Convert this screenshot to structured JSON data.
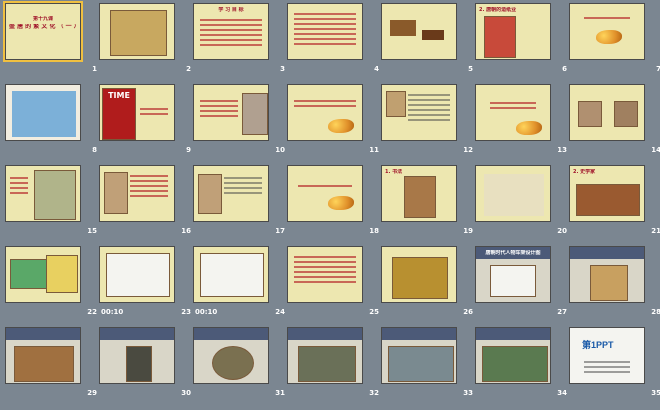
{
  "window": {
    "view": "slide-sorter"
  },
  "colors": {
    "background": "#7b8691",
    "slide_paper": "#ede7b0",
    "accent_red": "#a0142a",
    "number": "#ffffff"
  },
  "slides": [
    {
      "num": "1",
      "title": "第十九课",
      "subtitle": "盛 唐 的 繁 文 化 （ 一 ）",
      "timing": ""
    },
    {
      "num": "2",
      "title": "",
      "timing": ""
    },
    {
      "num": "3",
      "title": "学 习 目 标",
      "timing": ""
    },
    {
      "num": "4",
      "title": "",
      "timing": ""
    },
    {
      "num": "5",
      "title": "",
      "timing": ""
    },
    {
      "num": "6",
      "title": "2. 唐朝的造纸业",
      "timing": ""
    },
    {
      "num": "7",
      "title": "",
      "timing": ""
    },
    {
      "num": "8",
      "title": "",
      "timing": ""
    },
    {
      "num": "9",
      "title": "TIME",
      "timing": ""
    },
    {
      "num": "10",
      "title": "",
      "timing": ""
    },
    {
      "num": "11",
      "title": "",
      "timing": ""
    },
    {
      "num": "12",
      "title": "",
      "timing": ""
    },
    {
      "num": "13",
      "title": "",
      "timing": ""
    },
    {
      "num": "14",
      "title": "",
      "timing": ""
    },
    {
      "num": "15",
      "title": "",
      "timing": ""
    },
    {
      "num": "16",
      "title": "",
      "timing": ""
    },
    {
      "num": "17",
      "title": "",
      "timing": ""
    },
    {
      "num": "18",
      "title": "",
      "timing": ""
    },
    {
      "num": "19",
      "title": "1. 书法",
      "timing": ""
    },
    {
      "num": "20",
      "title": "",
      "timing": ""
    },
    {
      "num": "21",
      "title": "2. 史学家",
      "timing": ""
    },
    {
      "num": "22",
      "title": "",
      "timing": ""
    },
    {
      "num": "23",
      "title": "",
      "timing": "00:10"
    },
    {
      "num": "24",
      "title": "",
      "timing": "00:10"
    },
    {
      "num": "25",
      "title": "",
      "timing": ""
    },
    {
      "num": "26",
      "title": "",
      "timing": ""
    },
    {
      "num": "27",
      "title": "唐朝时代人物车架设计图",
      "timing": ""
    },
    {
      "num": "28",
      "title": "",
      "timing": ""
    },
    {
      "num": "29",
      "title": "",
      "timing": ""
    },
    {
      "num": "30",
      "title": "",
      "timing": ""
    },
    {
      "num": "31",
      "title": "",
      "timing": ""
    },
    {
      "num": "32",
      "title": "",
      "timing": ""
    },
    {
      "num": "33",
      "title": "",
      "timing": ""
    },
    {
      "num": "34",
      "title": "",
      "timing": ""
    },
    {
      "num": "35",
      "title": "第1PPT",
      "timing": ""
    }
  ]
}
